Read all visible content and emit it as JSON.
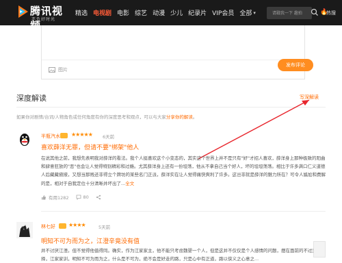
{
  "header": {
    "logo_text": "腾讯视频",
    "logo_sub": "不负好时光",
    "nav": [
      {
        "label": "精选",
        "active": false
      },
      {
        "label": "电视剧",
        "active": true
      },
      {
        "label": "电影",
        "active": false
      },
      {
        "label": "综艺",
        "active": false
      },
      {
        "label": "动漫",
        "active": false
      },
      {
        "label": "少儿",
        "active": false
      },
      {
        "label": "纪录片",
        "active": false
      },
      {
        "label": "VIP会员",
        "active": false
      },
      {
        "label": "全部",
        "active": false
      }
    ],
    "search_placeholder": "请戳我一下 趣拍",
    "hot_label": "热搜"
  },
  "editor": {
    "pic_label": "图片",
    "publish_label": "发布评论"
  },
  "section": {
    "title": "深度解读",
    "write_link": "写深解读",
    "subtitle_prefix": "如果你对剧情/台词/人物角色或任何角度有你的深度思考和观点，可以与大家",
    "subtitle_link": "分享你的解读",
    "subtitle_suffix": "。"
  },
  "reviews": [
    {
      "user": "半瓶汽水",
      "stars": "★★★★★",
      "time": "6天前",
      "title": "喜欢薛洋无罪，但请不要\"绑架\"他人",
      "body": "在说其他之前，我想先表明我对薛洋的看法。我个人挺喜欢这个小变态的，其实这个世界上并不是只有\"好\"才招人喜欢，薛洋身上那种极致的阳曲和肆意狂放的\"恶\"也会让人觉得特别精彩和过瘾。尤其薛洋身上还有一份坦荡，他从不拿自己当个好人，坏的坦坦荡荡。相比于许多满口仁义道德人后藏藏掖掖，又想当那贱还非得立个牌坊的某些名门正派，薛洋实在让人觉得痛快爽利了许多。这岂非就是薛洋的魅力所在？可令人尴尬和费解的是，相对于自我定位十分清晰并坏出了...",
      "more": "全文",
      "likes": "有用1282",
      "comments": "80"
    },
    {
      "user": "林七好",
      "stars": "★★★★",
      "time": "5天前",
      "title": "明知不可为而为之，江澄辛竟没有值",
      "body": "并不讨厌江澄。但不觉得他值得同。确实，作为江家家主，他不能只考虑魏婴一个人，但是这并不仅仅是个人感情的问题，摆在面前的不过是选择，江家家训，明知不可为而为之，什么是不可为，绝不会是好走的路，只是心中有正道，路以侠义之心意之..."
    }
  ]
}
